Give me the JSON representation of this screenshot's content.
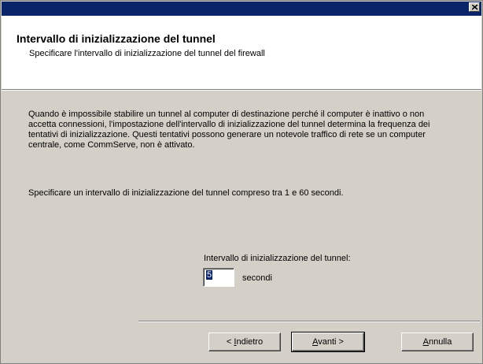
{
  "window": {
    "close_icon": "close-icon"
  },
  "header": {
    "title": "Intervallo di inizializzazione del tunnel",
    "subtitle": "Specificare l'intervallo di inizializzazione del tunnel del firewall"
  },
  "body": {
    "description": "Quando è impossibile stabilire un tunnel al computer di destinazione perché il computer è inattivo o non accetta connessioni, l'impostazione dell'intervallo di inizializzazione del tunnel determina la frequenza dei tentativi di inizializzazione.  Questi tentativi possono generare un notevole traffico di rete se un computer centrale, come CommServe, non è attivato.",
    "instruction": "Specificare un intervallo di inizializzazione del tunnel compreso tra 1 e 60 secondi.",
    "field_label": "Intervallo di inizializzazione del tunnel:",
    "field_value": "5",
    "unit_label": "secondi"
  },
  "buttons": {
    "back_prefix": "< ",
    "back_accel": "I",
    "back_rest": "ndietro",
    "next_accel": "A",
    "next_rest": "vanti >",
    "cancel_accel": "A",
    "cancel_rest": "nnulla"
  },
  "colors": {
    "titlebar": "#0a246a",
    "face": "#d4d0c8",
    "header_bg": "#ffffff"
  }
}
